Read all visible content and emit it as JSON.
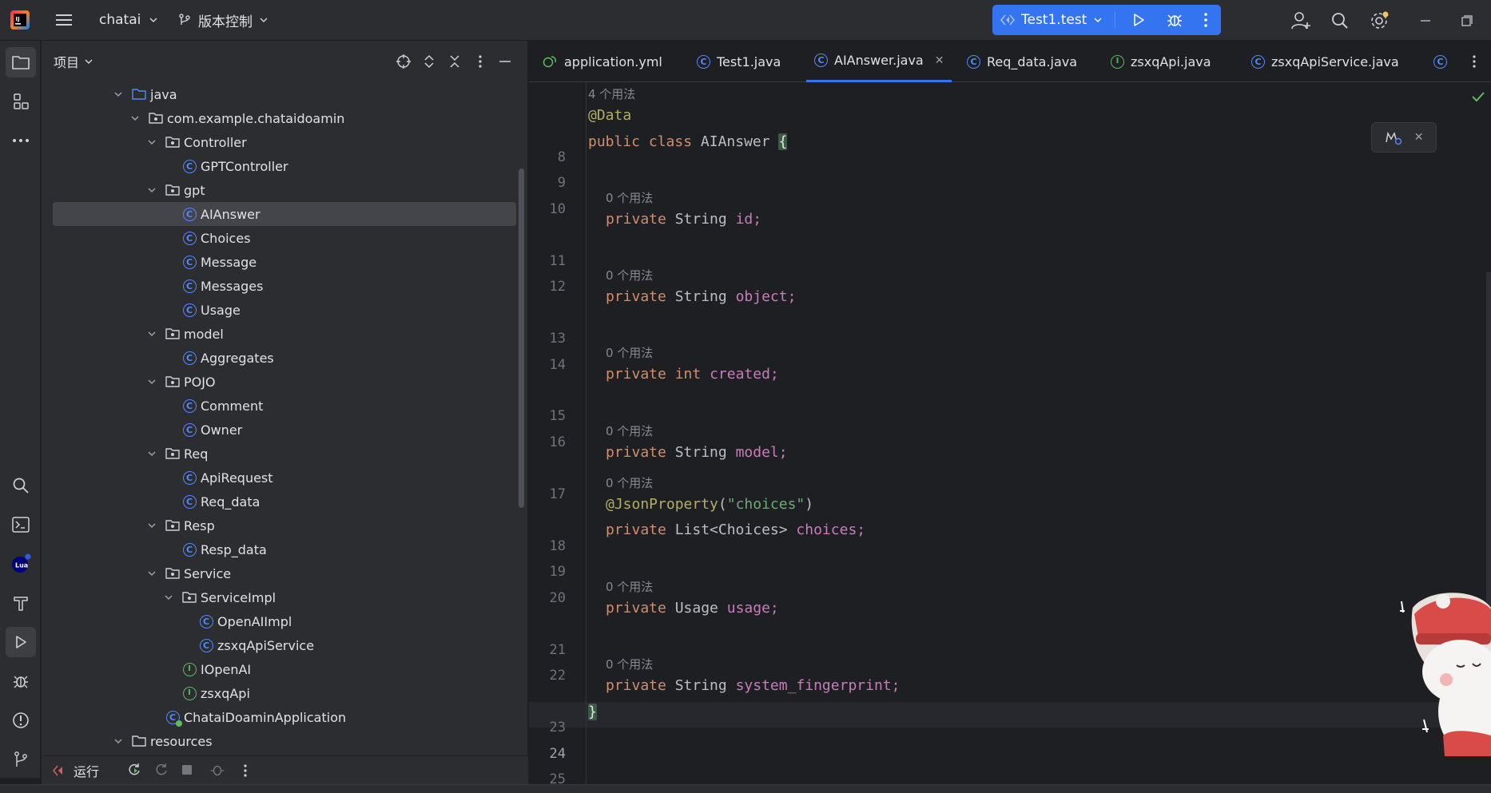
{
  "topbar": {
    "project_name": "chatai",
    "vcs_label": "版本控制",
    "run_config": "Test1.test",
    "icons": [
      "app-logo",
      "hamburger-icon",
      "chevron-down-icon",
      "branch-icon",
      "run-icon",
      "debug-icon",
      "more-vertical-icon",
      "add-user-icon",
      "search-icon",
      "settings-icon",
      "minimize-icon",
      "restore-icon"
    ],
    "accent_color": "#3574f0"
  },
  "toolstrip": {
    "top_icons": [
      "folder-icon",
      "structure-icon",
      "more-horizontal-icon"
    ],
    "bottom_icons": [
      "search-icon",
      "terminal-icon",
      "lua-icon",
      "hammer-icon",
      "run-icon",
      "debug-icon",
      "problems-icon",
      "git-icon"
    ],
    "lua_label": "Lua"
  },
  "project_panel": {
    "title": "项目",
    "tree": [
      {
        "label": "java",
        "kind": "folder-src",
        "depth": 0,
        "expanded": true
      },
      {
        "label": "com.example.chataidoamin",
        "kind": "package",
        "depth": 1,
        "expanded": true
      },
      {
        "label": "Controller",
        "kind": "package",
        "depth": 2,
        "expanded": true
      },
      {
        "label": "GPTController",
        "kind": "class",
        "depth": 3
      },
      {
        "label": "gpt",
        "kind": "package",
        "depth": 2,
        "expanded": true
      },
      {
        "label": "AIAnswer",
        "kind": "class",
        "depth": 3,
        "selected": true
      },
      {
        "label": "Choices",
        "kind": "class",
        "depth": 3
      },
      {
        "label": "Message",
        "kind": "class",
        "depth": 3
      },
      {
        "label": "Messages",
        "kind": "class",
        "depth": 3
      },
      {
        "label": "Usage",
        "kind": "class",
        "depth": 3
      },
      {
        "label": "model",
        "kind": "package",
        "depth": 2,
        "expanded": true
      },
      {
        "label": "Aggregates",
        "kind": "class",
        "depth": 3
      },
      {
        "label": "POJO",
        "kind": "package",
        "depth": 2,
        "expanded": true
      },
      {
        "label": "Comment",
        "kind": "class",
        "depth": 3
      },
      {
        "label": "Owner",
        "kind": "class",
        "depth": 3
      },
      {
        "label": "Req",
        "kind": "package",
        "depth": 2,
        "expanded": true
      },
      {
        "label": "ApiRequest",
        "kind": "class",
        "depth": 3
      },
      {
        "label": "Req_data",
        "kind": "class",
        "depth": 3
      },
      {
        "label": "Resp",
        "kind": "package",
        "depth": 2,
        "expanded": true
      },
      {
        "label": "Resp_data",
        "kind": "class",
        "depth": 3
      },
      {
        "label": "Service",
        "kind": "package",
        "depth": 2,
        "expanded": true
      },
      {
        "label": "ServiceImpl",
        "kind": "package",
        "depth": 3,
        "expanded": true
      },
      {
        "label": "OpenAIImpl",
        "kind": "class",
        "depth": 4
      },
      {
        "label": "zsxqApiService",
        "kind": "class",
        "depth": 4
      },
      {
        "label": "IOpenAI",
        "kind": "interface",
        "depth": 3
      },
      {
        "label": "zsxqApi",
        "kind": "interface",
        "depth": 3
      },
      {
        "label": "ChataiDoaminApplication",
        "kind": "app-class",
        "depth": 2
      },
      {
        "label": "resources",
        "kind": "folder-res",
        "depth": 0,
        "expanded": true
      }
    ]
  },
  "runbar": {
    "label": "运行"
  },
  "editor": {
    "tabs": [
      {
        "label": "application.yml",
        "icon": "yaml-icon"
      },
      {
        "label": "Test1.java",
        "icon": "class-icon"
      },
      {
        "label": "AIAnswer.java",
        "icon": "class-icon",
        "active": true
      },
      {
        "label": "Req_data.java",
        "icon": "class-icon"
      },
      {
        "label": "zsxqApi.java",
        "icon": "interface-icon"
      },
      {
        "label": "zsxqApiService.java",
        "icon": "class-icon"
      }
    ],
    "usage_hints": {
      "top": "4 个用法",
      "zero": "0 个用法"
    },
    "line_numbers": [
      "8",
      "9",
      "10",
      "11",
      "12",
      "13",
      "14",
      "15",
      "16",
      "17",
      "18",
      "19",
      "20",
      "21",
      "22",
      "23",
      "24",
      "25"
    ],
    "current_line": "24",
    "code": {
      "l8": "@Data",
      "l9_kw": "public class ",
      "l9_name": "AIAnswer ",
      "l9_brace": "{",
      "private": "private ",
      "string": "String ",
      "int": "int ",
      "f_id": "id;",
      "f_object": "object;",
      "f_created": "created;",
      "f_model": "model;",
      "ann_json": "@JsonProperty",
      "ann_open": "(",
      "ann_str": "\"choices\"",
      "ann_close": ")",
      "list_type": "List<Choices> ",
      "f_choices": "choices;",
      "usage_type": "Usage ",
      "f_usage": "usage;",
      "f_fp": "system_fingerprint;",
      "close_brace": "}"
    }
  }
}
